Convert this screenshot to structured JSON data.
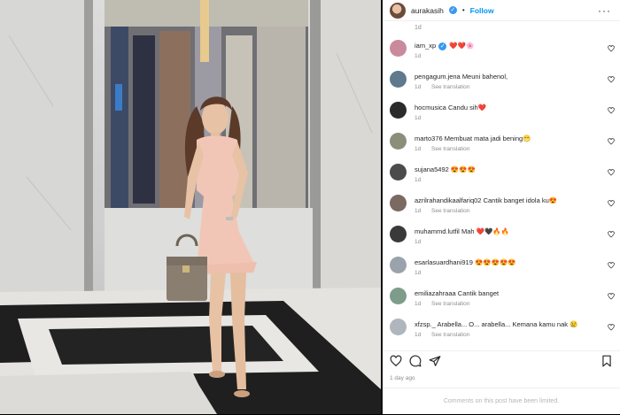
{
  "post": {
    "owner": "aurakasih",
    "follow_label": "Follow",
    "dot": "•",
    "more_label": "···",
    "top_time": "1d",
    "post_time": "1 day ago",
    "comments_limited": "Comments on this post have been limited."
  },
  "comments": [
    {
      "user": "iam_xp",
      "verified": true,
      "text": " ❤️❤️🌸",
      "time": "1d",
      "see_translation": ""
    },
    {
      "user": "pengagum.jena",
      "verified": false,
      "text": "Meuni bahenol,",
      "time": "1d",
      "see_translation": "See translation"
    },
    {
      "user": "hocmusica",
      "verified": false,
      "text": "Candu sih❤️",
      "time": "1d",
      "see_translation": ""
    },
    {
      "user": "marto376",
      "verified": false,
      "text": "Membuat mata jadi bening😁",
      "time": "1d",
      "see_translation": "See translation"
    },
    {
      "user": "sujana5492",
      "verified": false,
      "text": "😍😍😍",
      "time": "1d",
      "see_translation": ""
    },
    {
      "user": "azrilrahandikaalfariq02",
      "verified": false,
      "text": "Cantik banget idola ku😍",
      "time": "1d",
      "see_translation": "See translation"
    },
    {
      "user": "muhammd.lutfil",
      "verified": false,
      "text": "Mah ❤️🖤🔥🔥",
      "time": "1d",
      "see_translation": ""
    },
    {
      "user": "esarlasuardhani919",
      "verified": false,
      "text": "😍😍😍😍😍",
      "time": "1d",
      "see_translation": ""
    },
    {
      "user": "emiliazahraaa",
      "verified": false,
      "text": "Cantik banget",
      "time": "1d",
      "see_translation": "See translation"
    },
    {
      "user": "xfzsp._",
      "verified": false,
      "text": "Arabella... O... arabella... Kemana kamu nak 😢",
      "time": "1d",
      "see_translation": "See translation"
    }
  ],
  "icons": {
    "like": "heart-outline-icon",
    "comment": "comment-bubble-icon",
    "share": "paper-plane-icon",
    "save": "bookmark-icon",
    "more": "more-dots-icon",
    "verified": "verified-badge-icon"
  },
  "colors": {
    "accent": "#0095f6",
    "verified": "#3897f0",
    "dress": "#f2c6b6",
    "bag": "#8a7e70"
  }
}
